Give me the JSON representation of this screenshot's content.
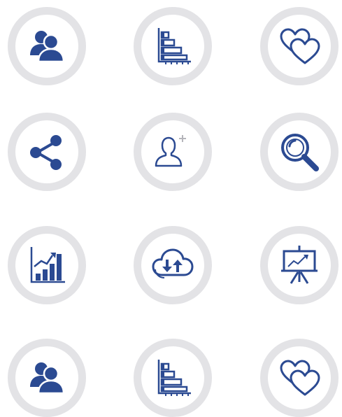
{
  "colors": {
    "icon": "#2b4a92",
    "ring": "#e3e3e6",
    "background": "#ffffff"
  },
  "icon_grid": {
    "rows": [
      [
        "users-icon",
        "bar-chart-icon",
        "hearts-icon"
      ],
      [
        "share-icon",
        "add-user-icon",
        "search-icon"
      ],
      [
        "growth-chart-icon",
        "cloud-sync-icon",
        "presentation-icon"
      ],
      [
        "users-icon",
        "bar-chart-icon",
        "hearts-icon"
      ]
    ]
  }
}
